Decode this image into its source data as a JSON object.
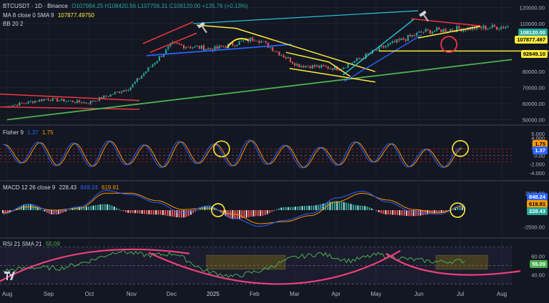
{
  "header": {
    "symbol": "BTCUSDT · 1D · Binance",
    "ohlc": "O107984.25 H108420.56 L107756.31 C108120.00 +135.76 (+0.13%)",
    "ma": "MA 8 close 0 SMA 9",
    "ma_value": "107877.49750",
    "bb": "BB 20 2",
    "fisher": "Fisher 9",
    "fisher_v1": "1.37",
    "fisher_v2": "1.75",
    "macd": "MACD 12 26 close 9",
    "macd_v1": "228.43",
    "macd_v2": "848.24",
    "macd_v3": "619.81",
    "rsi": "RSI 21 SMA 21",
    "rsi_v": "55.09"
  },
  "price_labels": {
    "price": "108120.00",
    "ma": "107877.497",
    "level": "92849.10",
    "fisher_a": "1.75",
    "fisher_b": "1.37",
    "macd_a": "848.24",
    "macd_b": "619.81",
    "macd_c": "228.43",
    "rsi": "55.09"
  },
  "colors": {
    "bg": "#131722",
    "up": "#26a69a",
    "down": "#ef5350",
    "yellow": "#ffeb3b",
    "green": "#4caf50",
    "blue": "#2962ff",
    "cyan": "#26c6da",
    "red": "#f23645",
    "orange": "#ff9800"
  },
  "chart_data": [
    {
      "type": "line",
      "title": "BTCUSDT · 1D · Binance",
      "x": [
        "Aug",
        "Sep",
        "Oct",
        "Nov",
        "Dec",
        "2025",
        "Feb",
        "Mar",
        "Apr",
        "May",
        "Jun",
        "Jul",
        "Aug"
      ],
      "series": [
        {
          "name": "BTCUSDT close",
          "values": [
            58000,
            63000,
            60500,
            70000,
            97000,
            94000,
            101000,
            84000,
            82000,
            95000,
            105000,
            107000,
            108120
          ]
        }
      ],
      "y_ticks": [
        "120000.00",
        "110000.00",
        "100000.00",
        "90000.00",
        "80000.00",
        "70000.00",
        "60000.00",
        "50000.00"
      ],
      "ylim": [
        48000,
        122000
      ],
      "level": 92849.1
    },
    {
      "type": "line",
      "title": "Fisher 9",
      "y_ticks": [
        "5.000",
        "4.000",
        "3.000",
        "2.000",
        "0.00",
        "-2.000",
        "-4.000"
      ],
      "ylim": [
        -5,
        5.5
      ],
      "series": [
        {
          "name": "Fisher",
          "values": [
            2.6,
            -1.8,
            3.1,
            -2.4,
            2.9,
            -2.6,
            3.4,
            -2.2,
            2.5,
            -2.8,
            3.3,
            -1.9,
            2.7,
            -2.5,
            3.6,
            -2.1,
            2.4,
            -2.9,
            1.9,
            -2.3,
            3.2,
            -1.6,
            2.8,
            -2.7,
            1.5,
            -2.8,
            1.75
          ]
        }
      ]
    },
    {
      "type": "bar",
      "title": "MACD 12 26 close 9",
      "y_ticks": [
        "2500.00",
        "0.00",
        "-2500.00"
      ],
      "ylim": [
        -3800,
        3600
      ],
      "series": [
        {
          "name": "MACD",
          "values": [
            -600,
            900,
            -300,
            500,
            2900,
            2300,
            1100,
            -400,
            600,
            -1200,
            -2400,
            -1500,
            -500,
            1800,
            2800,
            1200,
            -300,
            -600,
            848.24
          ]
        },
        {
          "name": "Signal",
          "values": [
            -400,
            500,
            0,
            300,
            2500,
            2500,
            1400,
            100,
            300,
            -600,
            -2000,
            -1700,
            -800,
            1200,
            2500,
            1500,
            100,
            -400,
            619.81
          ]
        },
        {
          "name": "Histogram",
          "values": [
            228.43
          ]
        }
      ]
    },
    {
      "type": "line",
      "title": "RSI 21 SMA 21",
      "y_ticks": [
        "60.00",
        "40.00"
      ],
      "ylim": [
        28,
        76
      ],
      "series": [
        {
          "name": "RSI",
          "values": [
            44,
            48,
            47,
            55,
            66,
            61,
            63,
            44,
            38,
            45,
            58,
            63,
            55,
            62,
            57,
            54,
            55.09
          ]
        }
      ]
    }
  ],
  "x_labels": [
    "Aug",
    "Sep",
    "Oct",
    "Nov",
    "Dec",
    "2025",
    "Feb",
    "Mar",
    "Apr",
    "May",
    "Jun",
    "Jul",
    "Aug"
  ]
}
